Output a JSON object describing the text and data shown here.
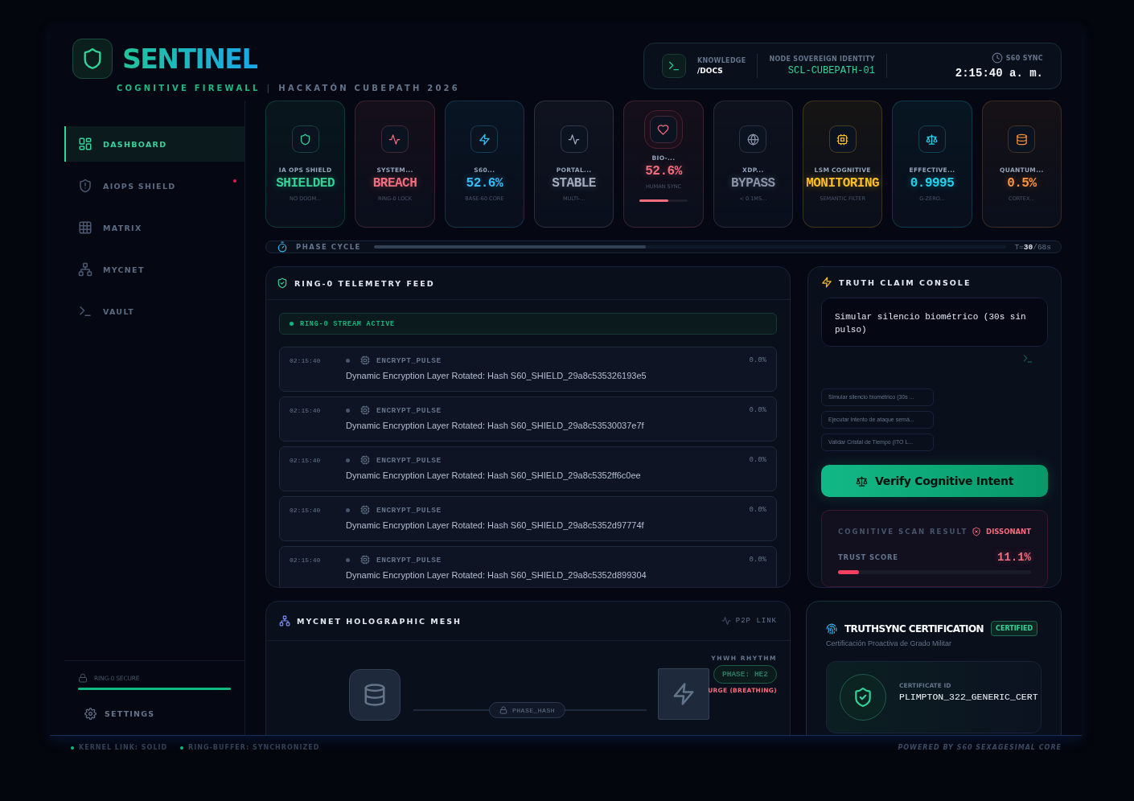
{
  "brand": {
    "name": "SENTINEL",
    "tagline": "COGNITIVE FIREWALL",
    "separator": "|",
    "event": "HACKATÓN CUBEPATH 2026"
  },
  "header_panel": {
    "knowledge_label": "KNOWLEDGE",
    "knowledge_link": "/DOCS",
    "identity_label": "NODE SOVEREIGN IDENTITY",
    "identity_value": "SCL-CUBEPATH-01",
    "sync_label": "S60 SYNC",
    "sync_time": "2:15:40 a. m."
  },
  "sidebar": {
    "items": [
      {
        "label": "DASHBOARD",
        "selected": true,
        "alert": false
      },
      {
        "label": "AIOPS SHIELD",
        "selected": false,
        "alert": true
      },
      {
        "label": "MATRIX",
        "selected": false,
        "alert": false
      },
      {
        "label": "MYCNET",
        "selected": false,
        "alert": false
      },
      {
        "label": "VAULT",
        "selected": false,
        "alert": false
      }
    ],
    "secure": {
      "label": "RING-0 SECURE",
      "level": 1
    },
    "settings": "SETTINGS"
  },
  "stat_cards": [
    {
      "label": "IA OPS SHIELD",
      "value": "SHIELDED",
      "sub": "NO DOOM...",
      "color": "#34d399"
    },
    {
      "label": "SYSTEM...",
      "value": "BREACH",
      "sub": "RING-0 LOCK",
      "color": "#f26d7d"
    },
    {
      "label": "S60...",
      "value": "52.6%",
      "sub": "BASE-60 CORE",
      "color": "#38bdf8"
    },
    {
      "label": "PORTAL...",
      "value": "STABLE",
      "sub": "MULTI-...",
      "color": "#a3adbf"
    },
    {
      "label": "BIO-...",
      "value": "52.6%",
      "sub": "HUMAN SYNC",
      "color": "#f26d7d",
      "level": 0.6
    },
    {
      "label": "XDP...",
      "value": "BYPASS",
      "sub": "< 0.1MS...",
      "color": "#8a94a8"
    },
    {
      "label": "LSM COGNITIVE",
      "value": "MONITORING",
      "sub": "SEMANTIC FILTER",
      "color": "#fbbf24"
    },
    {
      "label": "EFFECTIVE...",
      "value": "0.9995",
      "sub": "G-ZERO...",
      "color": "#22d3ee"
    },
    {
      "label": "QUANTUM...",
      "value": "0.5%",
      "sub": "CORTEX...",
      "color": "#fb923c"
    }
  ],
  "phase_cycle": {
    "label": "PHASE CYCLE",
    "level": 0.43,
    "reading": "T=**30**/68s"
  },
  "telemetry": {
    "title": "RING-0 TELEMETRY FEED",
    "stream": "RING-0 STREAM ACTIVE",
    "entries": [
      {
        "time": "02:15:40",
        "type": "ENCRYPT_PULSE",
        "percent": "0.0%",
        "message": "Dynamic Encryption Layer Rotated: Hash S60_SHIELD_29a8c535326193e5"
      },
      {
        "time": "02:15:40",
        "type": "ENCRYPT_PULSE",
        "percent": "0.0%",
        "message": "Dynamic Encryption Layer Rotated: Hash S60_SHIELD_29a8c53530037e7f"
      },
      {
        "time": "02:15:40",
        "type": "ENCRYPT_PULSE",
        "percent": "0.0%",
        "message": "Dynamic Encryption Layer Rotated: Hash S60_SHIELD_29a8c5352ff6c0ee"
      },
      {
        "time": "02:15:40",
        "type": "ENCRYPT_PULSE",
        "percent": "0.0%",
        "message": "Dynamic Encryption Layer Rotated: Hash S60_SHIELD_29a8c5352d97774f"
      },
      {
        "time": "02:15:40",
        "type": "ENCRYPT_PULSE",
        "percent": "0.0%",
        "message": "Dynamic Encryption Layer Rotated: Hash S60_SHIELD_29a8c5352d899304"
      }
    ]
  },
  "console": {
    "title": "TRUTH CLAIM CONSOLE",
    "input_value": "Simular silencio biométrico (30s sin pulso)",
    "suggestions": [
      "Simular silencio biométrico (30s ...",
      "Ejecutar intento de ataque semá...",
      "Validar Cristal de Tiempo (ITO L..."
    ],
    "button": "Verify Cognitive Intent",
    "result_label": "COGNITIVE SCAN RESULT",
    "result_status": "DISSONANT",
    "trust": {
      "label": "TRUST SCORE",
      "value": "11.1%",
      "level": 0.11
    }
  },
  "mesh": {
    "title": "MYCNET HOLOGRAPHIC MESH",
    "link": "P2P LINK",
    "rhythm_label": "YHWH RHYTHM",
    "phase": "PHASE: HE2",
    "urge": "URGE (BREATHING)",
    "hash": "PHASE_HASH"
  },
  "certification": {
    "title": "TRUTHSYNC CERTIFICATION",
    "badge": "CERTIFIED",
    "subtitle": "Certificación Proactiva de Grado Militar",
    "id_label": "CERTIFICATE ID",
    "id_value": "PLIMPTON_322_GENERIC_CERT"
  },
  "footer": {
    "status": [
      "KERNEL LINK: SOLID",
      "RING-BUFFER: SYNCHRONIZED"
    ],
    "powered": "POWERED BY S60 SEXAGESIMAL CORE"
  }
}
